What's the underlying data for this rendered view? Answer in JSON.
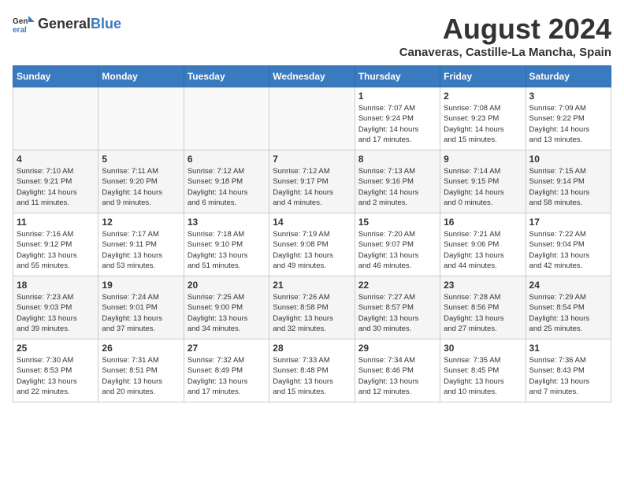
{
  "logo": {
    "general": "General",
    "blue": "Blue"
  },
  "title": {
    "month_year": "August 2024",
    "location": "Canaveras, Castille-La Mancha, Spain"
  },
  "weekdays": [
    "Sunday",
    "Monday",
    "Tuesday",
    "Wednesday",
    "Thursday",
    "Friday",
    "Saturday"
  ],
  "weeks": [
    [
      {
        "day": "",
        "info": ""
      },
      {
        "day": "",
        "info": ""
      },
      {
        "day": "",
        "info": ""
      },
      {
        "day": "",
        "info": ""
      },
      {
        "day": "1",
        "info": "Sunrise: 7:07 AM\nSunset: 9:24 PM\nDaylight: 14 hours\nand 17 minutes."
      },
      {
        "day": "2",
        "info": "Sunrise: 7:08 AM\nSunset: 9:23 PM\nDaylight: 14 hours\nand 15 minutes."
      },
      {
        "day": "3",
        "info": "Sunrise: 7:09 AM\nSunset: 9:22 PM\nDaylight: 14 hours\nand 13 minutes."
      }
    ],
    [
      {
        "day": "4",
        "info": "Sunrise: 7:10 AM\nSunset: 9:21 PM\nDaylight: 14 hours\nand 11 minutes."
      },
      {
        "day": "5",
        "info": "Sunrise: 7:11 AM\nSunset: 9:20 PM\nDaylight: 14 hours\nand 9 minutes."
      },
      {
        "day": "6",
        "info": "Sunrise: 7:12 AM\nSunset: 9:18 PM\nDaylight: 14 hours\nand 6 minutes."
      },
      {
        "day": "7",
        "info": "Sunrise: 7:12 AM\nSunset: 9:17 PM\nDaylight: 14 hours\nand 4 minutes."
      },
      {
        "day": "8",
        "info": "Sunrise: 7:13 AM\nSunset: 9:16 PM\nDaylight: 14 hours\nand 2 minutes."
      },
      {
        "day": "9",
        "info": "Sunrise: 7:14 AM\nSunset: 9:15 PM\nDaylight: 14 hours\nand 0 minutes."
      },
      {
        "day": "10",
        "info": "Sunrise: 7:15 AM\nSunset: 9:14 PM\nDaylight: 13 hours\nand 58 minutes."
      }
    ],
    [
      {
        "day": "11",
        "info": "Sunrise: 7:16 AM\nSunset: 9:12 PM\nDaylight: 13 hours\nand 55 minutes."
      },
      {
        "day": "12",
        "info": "Sunrise: 7:17 AM\nSunset: 9:11 PM\nDaylight: 13 hours\nand 53 minutes."
      },
      {
        "day": "13",
        "info": "Sunrise: 7:18 AM\nSunset: 9:10 PM\nDaylight: 13 hours\nand 51 minutes."
      },
      {
        "day": "14",
        "info": "Sunrise: 7:19 AM\nSunset: 9:08 PM\nDaylight: 13 hours\nand 49 minutes."
      },
      {
        "day": "15",
        "info": "Sunrise: 7:20 AM\nSunset: 9:07 PM\nDaylight: 13 hours\nand 46 minutes."
      },
      {
        "day": "16",
        "info": "Sunrise: 7:21 AM\nSunset: 9:06 PM\nDaylight: 13 hours\nand 44 minutes."
      },
      {
        "day": "17",
        "info": "Sunrise: 7:22 AM\nSunset: 9:04 PM\nDaylight: 13 hours\nand 42 minutes."
      }
    ],
    [
      {
        "day": "18",
        "info": "Sunrise: 7:23 AM\nSunset: 9:03 PM\nDaylight: 13 hours\nand 39 minutes."
      },
      {
        "day": "19",
        "info": "Sunrise: 7:24 AM\nSunset: 9:01 PM\nDaylight: 13 hours\nand 37 minutes."
      },
      {
        "day": "20",
        "info": "Sunrise: 7:25 AM\nSunset: 9:00 PM\nDaylight: 13 hours\nand 34 minutes."
      },
      {
        "day": "21",
        "info": "Sunrise: 7:26 AM\nSunset: 8:58 PM\nDaylight: 13 hours\nand 32 minutes."
      },
      {
        "day": "22",
        "info": "Sunrise: 7:27 AM\nSunset: 8:57 PM\nDaylight: 13 hours\nand 30 minutes."
      },
      {
        "day": "23",
        "info": "Sunrise: 7:28 AM\nSunset: 8:56 PM\nDaylight: 13 hours\nand 27 minutes."
      },
      {
        "day": "24",
        "info": "Sunrise: 7:29 AM\nSunset: 8:54 PM\nDaylight: 13 hours\nand 25 minutes."
      }
    ],
    [
      {
        "day": "25",
        "info": "Sunrise: 7:30 AM\nSunset: 8:53 PM\nDaylight: 13 hours\nand 22 minutes."
      },
      {
        "day": "26",
        "info": "Sunrise: 7:31 AM\nSunset: 8:51 PM\nDaylight: 13 hours\nand 20 minutes."
      },
      {
        "day": "27",
        "info": "Sunrise: 7:32 AM\nSunset: 8:49 PM\nDaylight: 13 hours\nand 17 minutes."
      },
      {
        "day": "28",
        "info": "Sunrise: 7:33 AM\nSunset: 8:48 PM\nDaylight: 13 hours\nand 15 minutes."
      },
      {
        "day": "29",
        "info": "Sunrise: 7:34 AM\nSunset: 8:46 PM\nDaylight: 13 hours\nand 12 minutes."
      },
      {
        "day": "30",
        "info": "Sunrise: 7:35 AM\nSunset: 8:45 PM\nDaylight: 13 hours\nand 10 minutes."
      },
      {
        "day": "31",
        "info": "Sunrise: 7:36 AM\nSunset: 8:43 PM\nDaylight: 13 hours\nand 7 minutes."
      }
    ]
  ]
}
